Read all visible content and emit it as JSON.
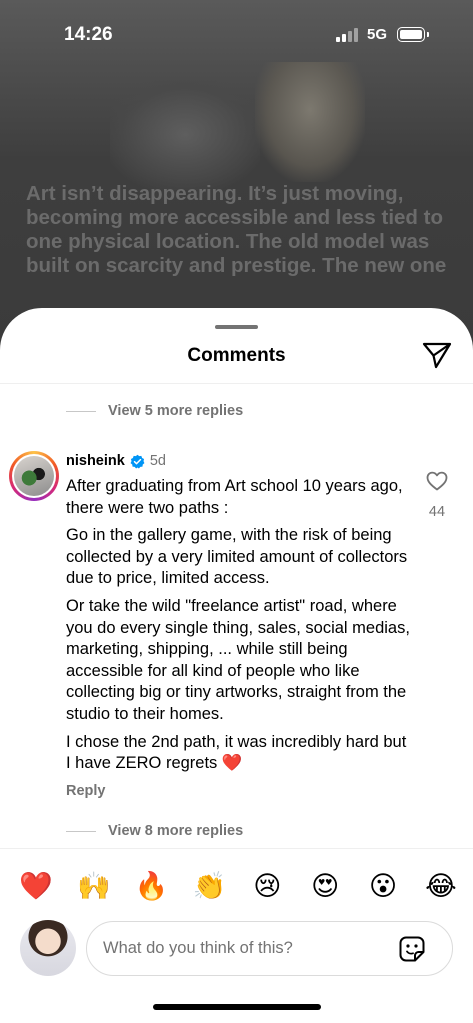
{
  "status_bar": {
    "time": "14:26",
    "network": "5G"
  },
  "background_post": {
    "text": "Art isn’t disappearing. It’s just moving, becoming more accessible and less tied to one physical location. The old model was built on scarcity and prestige. The new one"
  },
  "sheet": {
    "title": "Comments",
    "share_icon": "paper-plane-icon"
  },
  "replies_top": {
    "label": "View 5 more replies"
  },
  "comment": {
    "username": "nisheink",
    "verified_icon": "verified-badge-icon",
    "time": "5d",
    "paragraphs": [
      "After graduating from Art school 10 years ago, there were two paths :",
      "Go in the gallery game, with the risk of being collected by a very limited amount of collectors due to price, limited access.",
      "Or take the wild \"freelance artist\" road, where you do every single thing, sales, social medias, marketing, shipping, ... while still being accessible for all kind of people who like collecting big or tiny artworks, straight from the studio to their homes.",
      "I chose the 2nd path, it was incredibly hard but I have ZERO regrets ❤️"
    ],
    "reply_label": "Reply",
    "like_icon": "heart-outline-icon",
    "like_count": "44"
  },
  "replies_bottom": {
    "label": "View 8 more replies"
  },
  "reactions": [
    "❤️",
    "🙌",
    "🔥",
    "👏",
    "😢",
    "😍",
    "😮",
    "😂"
  ],
  "composer": {
    "placeholder": "What do you think of this?",
    "sticker_icon": "sticker-icon"
  },
  "colors": {
    "secondary_text": "#737373",
    "verified_blue": "#0095f6",
    "divider": "#efefef"
  }
}
